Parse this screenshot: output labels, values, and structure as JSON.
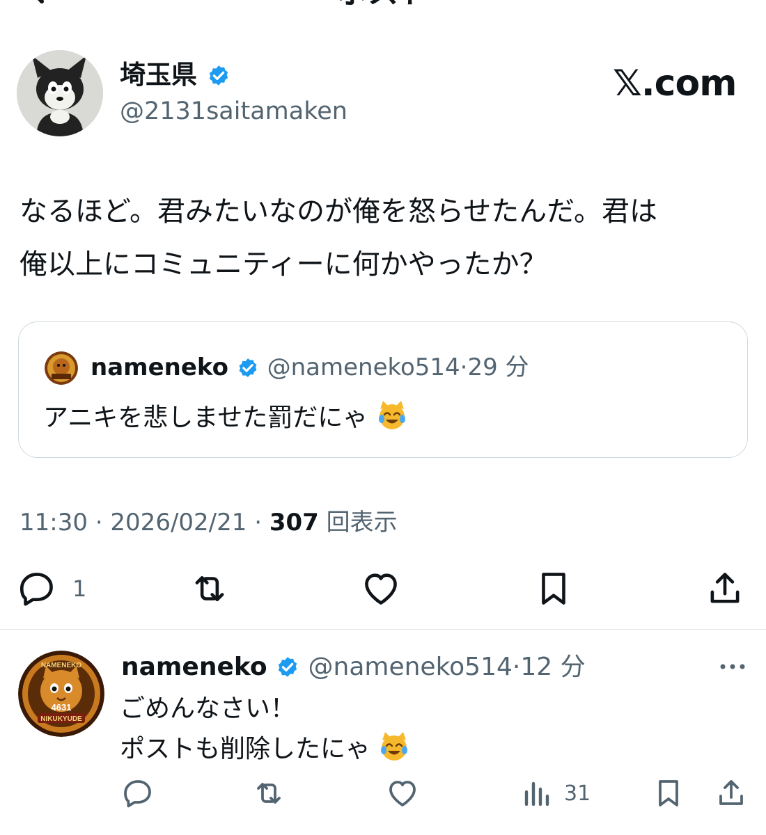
{
  "header": {
    "title": "ポスト"
  },
  "post": {
    "author_name": "埼玉県",
    "author_handle": "@2131saitamaken",
    "brand": "𝕏.com",
    "text_line1": "なるほど。君みたいなのが俺を怒らせたんだ。君は",
    "text_line2": "俺以上にコミュニティーに何かやったか？",
    "quote": {
      "name": "nameneko",
      "handle": "@nameneko514",
      "sep": "·",
      "time": "29 分",
      "text": "アニキを悲しませた罰だにゃ"
    },
    "meta": {
      "time": "11:30",
      "sep1": " · ",
      "date": "2026/02/21",
      "sep2": " · ",
      "views": "307",
      "views_label": " 回表示"
    },
    "actions": {
      "reply_count": "1"
    }
  },
  "reply": {
    "name": "nameneko",
    "handle": "@nameneko514",
    "sep": "·",
    "time": "12 分",
    "line1": "ごめんなさい！",
    "line2": "ポストも削除したにゃ",
    "views_count": "31"
  },
  "avatar_text": {
    "top": "NAMENEKO",
    "num": "4631",
    "bottom": "NIKUKYUDE"
  },
  "colors": {
    "verified": "#1d9bf0",
    "secondary": "#536471",
    "text": "#0f1419",
    "border": "#cfd9de"
  }
}
